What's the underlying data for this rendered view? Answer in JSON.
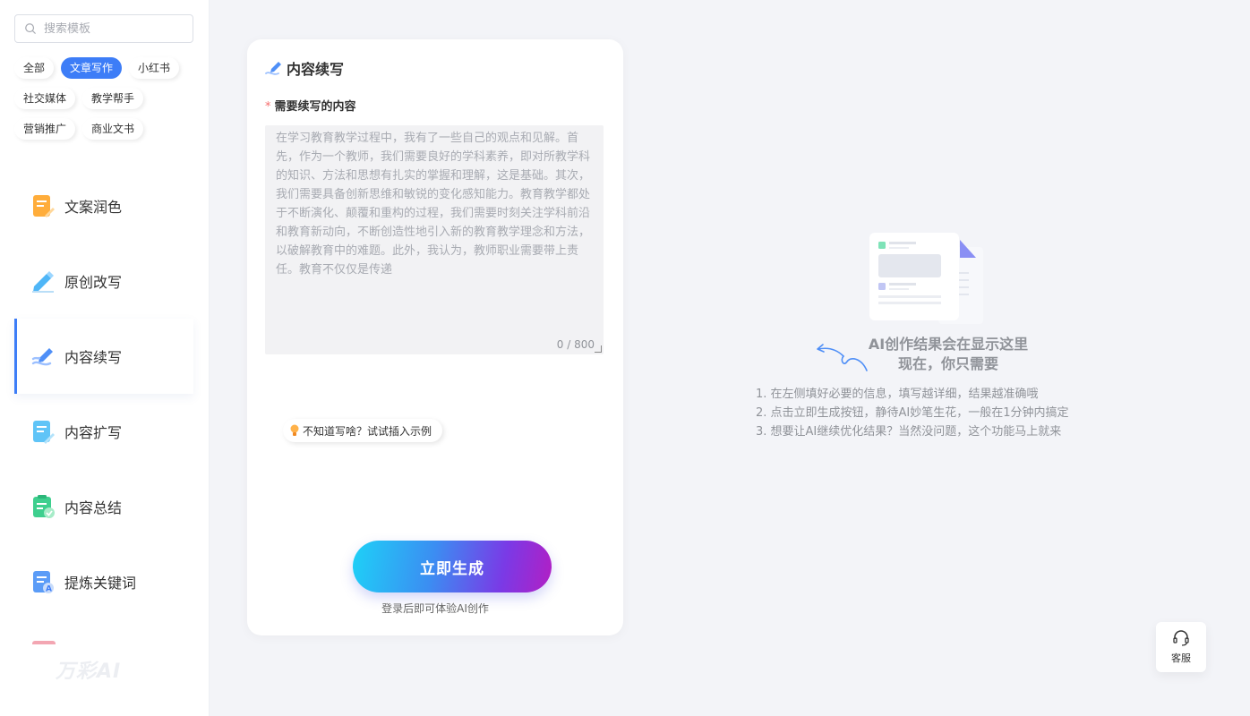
{
  "sidebar": {
    "search_placeholder": "搜索模板",
    "tags": [
      [
        "全部",
        "文章写作",
        "小红书"
      ],
      [
        "社交媒体",
        "教学帮手"
      ],
      [
        "营销推广",
        "商业文书"
      ]
    ],
    "menu": [
      {
        "label": "文案润色",
        "icon": "document-edit-icon"
      },
      {
        "label": "原创改写",
        "icon": "pencil-icon"
      },
      {
        "label": "内容续写",
        "icon": "pen-continue-icon"
      },
      {
        "label": "内容扩写",
        "icon": "document-expand-icon"
      },
      {
        "label": "内容总结",
        "icon": "clipboard-check-icon"
      },
      {
        "label": "提炼关键词",
        "icon": "document-search-icon"
      }
    ],
    "logo": "万彩AI"
  },
  "form": {
    "title": "内容续写",
    "field_label": "需要续写的内容",
    "required_mark": "*",
    "placeholder": "在学习教育教学过程中，我有了一些自己的观点和见解。首先，作为一个教师，我们需要良好的学科素养，即对所教学科的知识、方法和思想有扎实的掌握和理解，这是基础。其次，我们需要具备创新思维和敏锐的变化感知能力。教育教学都处于不断演化、颠覆和重构的过程，我们需要时刻关注学科前沿和教育新动向，不断创造性地引入新的教育教学理念和方法，以破解教育中的难题。此外，我认为，教师职业需要带上责任。教育不仅仅是传递",
    "value": "",
    "counter": "0 / 800",
    "example_label": "不知道写啥？试试插入示例",
    "generate_label": "立即生成",
    "login_tip": "登录后即可体验AI创作"
  },
  "result": {
    "title_line1": "AI创作结果会在显示这里",
    "title_line2": "现在，你只需要",
    "tips": [
      "1. 在左侧填好必要的信息，填写越详细，结果越准确哦",
      "2. 点击立即生成按钮，静待AI妙笔生花，一般在1分钟内搞定",
      "3. 想要让AI继续优化结果？当然没问题，这个功能马上就来"
    ]
  },
  "service": {
    "label": "客服"
  },
  "colors": {
    "accent": "#3d7df7",
    "required": "#f56c6c"
  }
}
